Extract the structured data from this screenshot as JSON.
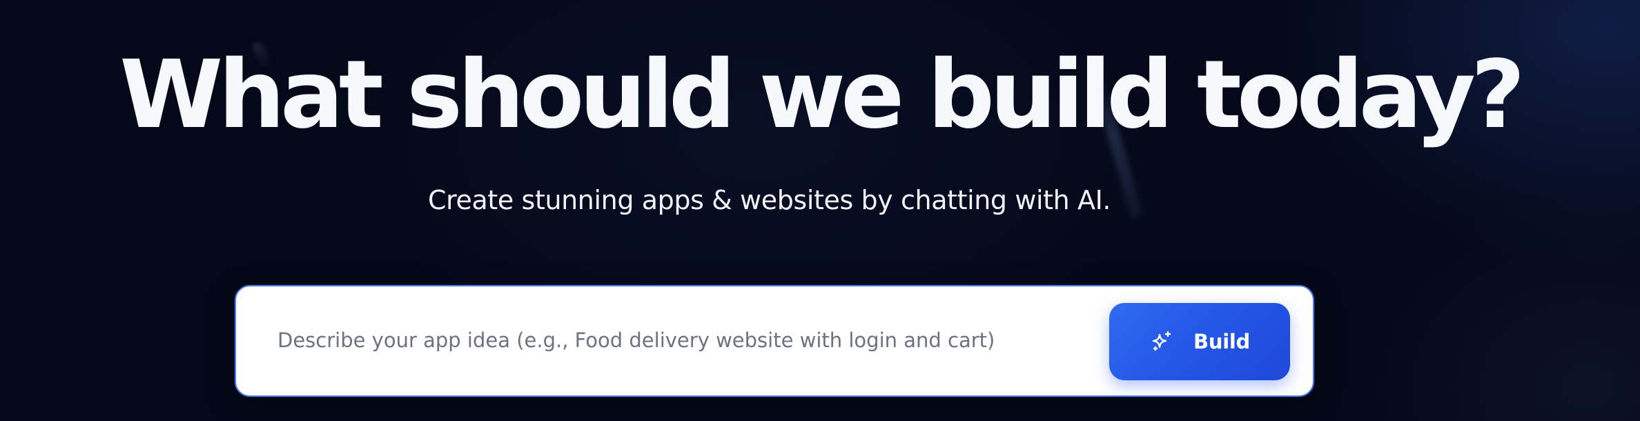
{
  "hero": {
    "title": "What should we build today?",
    "subtitle": "Create stunning apps & websites by chatting with AI."
  },
  "prompt": {
    "value": "",
    "placeholder": "Describe your app idea (e.g., Food delivery website with login and cart)"
  },
  "build_button": {
    "label": "Build",
    "icon": "sparkles-icon"
  },
  "colors": {
    "background": "#040919",
    "title": "#f6f8fb",
    "accent": "#2456e6",
    "input_border": "#4a78e4",
    "placeholder": "#6b7280"
  }
}
